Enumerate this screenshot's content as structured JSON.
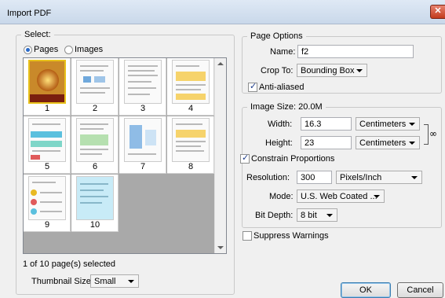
{
  "window": {
    "title": "Import PDF",
    "close_glyph": "✕"
  },
  "select": {
    "legend": "Select:",
    "options": [
      {
        "label": "Pages",
        "selected": true
      },
      {
        "label": "Images",
        "selected": false
      }
    ],
    "thumbnails": [
      {
        "number": "1",
        "selected": true
      },
      {
        "number": "2",
        "selected": false
      },
      {
        "number": "3",
        "selected": false
      },
      {
        "number": "4",
        "selected": false
      },
      {
        "number": "5",
        "selected": false
      },
      {
        "number": "6",
        "selected": false
      },
      {
        "number": "7",
        "selected": false
      },
      {
        "number": "8",
        "selected": false
      },
      {
        "number": "9",
        "selected": false
      },
      {
        "number": "10",
        "selected": false
      }
    ],
    "status": "1 of 10 page(s) selected",
    "thumbnail_size_label": "Thumbnail Size:",
    "thumbnail_size_value": "Small"
  },
  "page_options": {
    "legend": "Page Options",
    "name_label": "Name:",
    "name_value": "f2",
    "crop_label": "Crop To:",
    "crop_value": "Bounding Box",
    "anti_aliased_label": "Anti-aliased",
    "anti_aliased_checked": true
  },
  "image_size": {
    "legend": "Image Size: 20.0M",
    "width_label": "Width:",
    "width_value": "16.3",
    "width_unit": "Centimeters",
    "height_label": "Height:",
    "height_value": "23",
    "height_unit": "Centimeters",
    "link_icon": "chain-link-icon",
    "constrain_label": "Constrain Proportions",
    "constrain_checked": true,
    "resolution_label": "Resolution:",
    "resolution_value": "300",
    "resolution_unit": "Pixels/Inch",
    "mode_label": "Mode:",
    "mode_value": "U.S. Web Coated ...",
    "bit_depth_label": "Bit Depth:",
    "bit_depth_value": "8 bit"
  },
  "suppress_label": "Suppress Warnings",
  "suppress_checked": false,
  "buttons": {
    "ok": "OK",
    "cancel": "Cancel"
  },
  "colors": {
    "accent": "#2a6ac8",
    "page_highlight": "#e8c11a",
    "thumb_bg": "#a9a9a9"
  }
}
